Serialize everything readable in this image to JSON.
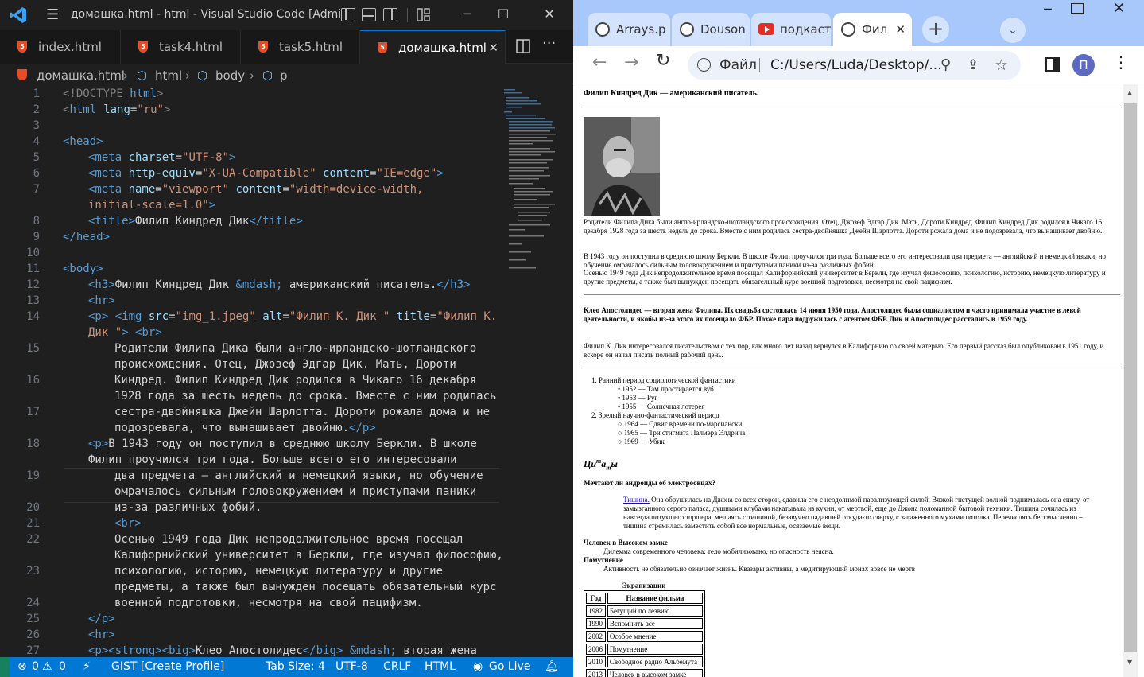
{
  "vscode": {
    "title": "домашка.html - html - Visual Studio Code [Admi...",
    "tabs": [
      {
        "label": "index.html"
      },
      {
        "label": "task4.html"
      },
      {
        "label": "task5.html"
      },
      {
        "label": "домашка.html"
      }
    ],
    "breadcrumb": [
      "домашка.html",
      "html",
      "body",
      "p"
    ],
    "line_numbers": [
      "1",
      "2",
      "3",
      "4",
      "5",
      "6",
      "7",
      "8",
      "9",
      "10",
      "11",
      "12",
      "13",
      "14",
      "15",
      "16",
      "17",
      "18",
      "19",
      "20",
      "21",
      "22",
      "23",
      "24",
      "25",
      "26",
      "27"
    ],
    "code": {
      "l1a": "<!DOCTYPE ",
      "l1b": "html",
      "l1c": ">",
      "l2a": "<html ",
      "l2b": "lang",
      "l2c": "=",
      "l2d": "\"ru\"",
      "l2e": ">",
      "l4": "<head>",
      "l5a": "<meta ",
      "l5b": "charset",
      "l5c": "=",
      "l5d": "\"UTF-8\"",
      "l5e": ">",
      "l6a": "<meta ",
      "l6b": "http-equiv",
      "l6c": "=",
      "l6d": "\"X-UA-Compatible\"",
      "l6e": " content",
      "l6f": "=",
      "l6g": "\"IE=edge\"",
      "l6h": ">",
      "l7a": "<meta ",
      "l7b": "name",
      "l7c": "=",
      "l7d": "\"viewport\"",
      "l7e": " content",
      "l7f": "=",
      "l7g": "\"width=device-width,",
      "l7w": "initial-scale=1.0\"",
      "l7x": ">",
      "l8a": "<title>",
      "l8b": "Филип Киндред Дик",
      "l8c": "</title>",
      "l9": "</head>",
      "l11": "<body>",
      "l12a": "<h3>",
      "l12b": "Филип Киндред Дик ",
      "l12c": "&mdash;",
      "l12d": " американский писатель.",
      "l12e": "</h3>",
      "l13": "<hr>",
      "l14a": "<p>",
      "l14b": " <img ",
      "l14c": "src",
      "l14d": "=",
      "l14e": "\"img_1.jpeg\"",
      "l14f": " alt",
      "l14g": "=",
      "l14h": "\"Филип К. Дик \"",
      "l14i": " title",
      "l14j": "=",
      "l14k": "\"Филип К.",
      "l14w1": "Дик \"",
      "l14w2": ">",
      "l14w3": " <br>",
      "l15a": "Родители Филипа Дика были англо-ирландско-шотландского",
      "l15b": "происхождения. Отец, Джозеф Эдгар Дик. Мать, Дороти",
      "l16a": "Киндред. Филип Киндред Дик родился в Чикаго 16 декабря",
      "l16b": "1928 года за шесть недель до срока. Вместе с ним родилась",
      "l17a": "сестра-двойняшка Джейн Шарлотта. Дороти рожала дома и не",
      "l17b": "подозревала, что вынашивает двойню.",
      "l17c": "</p>",
      "l18a": "<p>",
      "l18b": "В 1943 году он поступил в среднюю школу Беркли. В школе",
      "l18w": "Филип проучился три года. Больше всего его интересовали",
      "l19a": "два предмета — английский и немецкий языки, но обучение",
      "l19b": "омрачалось сильным головокружением и приступами паники",
      "l20": "из-за различных фобий.",
      "l21": "<br>",
      "l22a": "Осенью 1949 года Дик непродолжительное время посещал",
      "l22b": "Калифорнийский университет в Беркли, где изучал философию,",
      "l23a": "психологию, историю, немецкую литературу и другие",
      "l23b": "предметы, а также был вынужден посещать обязательный курс",
      "l24": "военной подготовки, несмотря на свой пацифизм.",
      "l25": "</p>",
      "l26": "<hr>",
      "l27a": "<p>",
      "l27b": "<strong>",
      "l27c": "<big>",
      "l27d": "Клео Апостолидес",
      "l27e": "</big>",
      "l27f": " &mdash;",
      "l27g": " вторая жена"
    },
    "status": {
      "problems": "0",
      "warnings": "0",
      "gist": "GIST [Create Profile]",
      "tab_size": "Tab Size: 4",
      "encoding": "UTF-8",
      "eol": "CRLF",
      "language": "HTML",
      "go_live": "Go Live"
    }
  },
  "browser": {
    "tabs": [
      {
        "label": "Arrays.p",
        "icon": "globe-icon"
      },
      {
        "label": "Douson",
        "icon": "globe-icon"
      },
      {
        "label": "подкаст",
        "icon": "youtube-icon"
      },
      {
        "label": "Фил",
        "icon": "globe-icon"
      }
    ],
    "address_scheme": "Файл",
    "address": "C:/Users/Luda/Desktop/...",
    "profile_initial": "П",
    "page": {
      "h3": "Филип Киндред Дик — американский писатель.",
      "p1": "Родители Филипа Дика были англо-ирландско-шотландского происхождения. Отец, Джозеф Эдгар Дик. Мать, Дороти Киндред. Филип Киндред Дик родился в Чикаго 16 декабря 1928 года за шесть недель до срока. Вместе с ним родилась сестра-двойняшка Джейн Шарлотта. Дороти рожала дома и не подозревала, что вынашивает двойню.",
      "p2a": "В 1943 году он поступил в среднюю школу Беркли. В школе Филип проучился три года. Больше всего его интересовали два предмета — английский и немецкий языки, но обучение омрачалось сильным головокружением и приступами паники из-за различных фобий.",
      "p2b": "Осенью 1949 года Дик непродолжительное время посещал Калифорнийский университет в Беркли, где изучал философию, психологию, историю, немецкую литературу и другие предметы, а также был вынужден посещать обязательный курс военной подготовки, несмотря на свой пацифизм.",
      "p3": "Клео Апостолидес — вторая жена Филипа. Их свадьба состоялась 14 июня 1950 года. Апостолидес была социалистом и часто принимала участие в левой деятельности, и якобы из-за этого их посещало ФБР. Позже пара подружилась с агентом ФБР. Дик и Апостолидес расстались в 1959 году.",
      "p4": "Филип К. Дик интересовался писательством с тех пор, как много лет назад вернулся в Калифорнию со своей матерью. Его первый рассказ был опубликован в 1951 году, и вскоре он начал писать полный рабочий день.",
      "list": [
        {
          "title": "Ранний период социологической фантастики",
          "items": [
            "1952 — Там простирается вуб",
            "1953 — Руг",
            "1955 — Солнечная лотерея"
          ]
        },
        {
          "title": "Зрелый научно-фантастический период",
          "items": [
            "1964 — Сдвиг времени по-марсиански",
            "1965 — Три стигмата Палмера Элдрича",
            "1969 — Убик"
          ]
        }
      ],
      "quotes_c1": "Ци",
      "quotes_c2": "т",
      "quotes_c3": "а",
      "quotes_c4": "т",
      "quotes_c5": "ы",
      "q_title": "Мечтают ли андроиды об электроовцах?",
      "q_link": "Тишина.",
      "q_text": " Она обрушилась на Джона со всех сторон, сдавила его с неодолимой парализующей силой. Вязкой гнетущей волной поднималась она снизу, от замызганного серого паласа, душными клубами накатывала из кухни, от мертвой, еще до Джона поломанной бытовой техники. Тишина сочилась из навсегда потухшего торшера, мешаясь с тишиной, беззвучно падавшей откуда-то сверху, с загаженного мухами потолка. Перечислять бессмысленно – тишина стремилась заместить собой все нормальные, осязаемые вещи.",
      "dt1": "Человек в Высоком замке",
      "dd1": "Дилемма современного человека: тело мобилизовано, но опасность неясна.",
      "dt2": "Помутнение",
      "dd2": "Активность не обязательно означает жизнь. Квазары активны, а медитирующий монах вовсе не мертв",
      "table_caption": "Экранизации",
      "table_headers": [
        "Год",
        "Название фильма"
      ],
      "table_rows": [
        [
          "1982",
          "Бегущий по лезвию"
        ],
        [
          "1990",
          "Вспомнить все"
        ],
        [
          "2002",
          "Особое мнение"
        ],
        [
          "2006",
          "Помутнение"
        ],
        [
          "2010",
          "Свободное радио Альбемута"
        ],
        [
          "2013",
          "Человек в высоком замке"
        ]
      ]
    }
  },
  "colors": {
    "vscode_accent": "#0078d4",
    "browser_frame": "#a8c7fa",
    "tag": "#569cd6",
    "attr": "#9cdcfe",
    "string": "#ce9178"
  }
}
